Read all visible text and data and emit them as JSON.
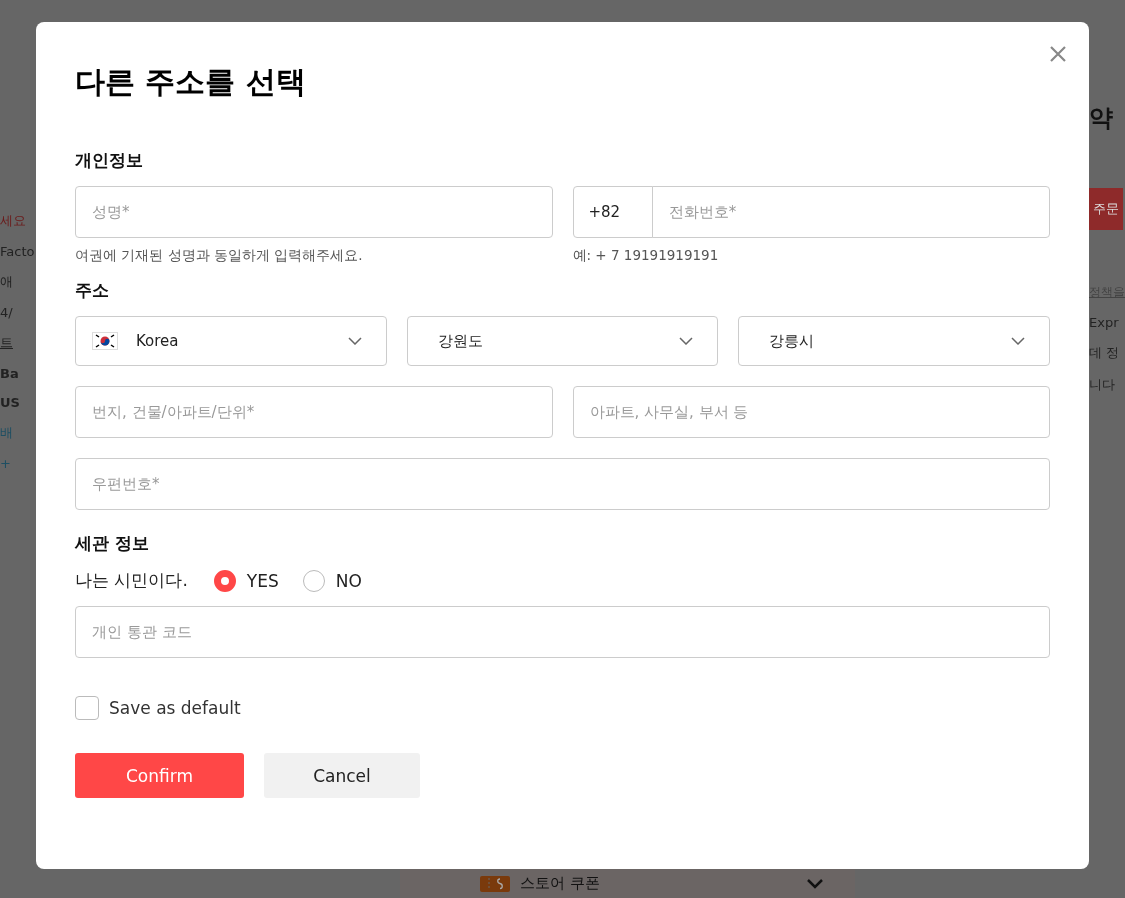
{
  "background": {
    "left_texts": [
      {
        "text": "세요",
        "kind": "warning"
      },
      {
        "text": "Facto",
        "kind": "plain"
      },
      {
        "text": "애",
        "kind": "plain"
      },
      {
        "text": "4/",
        "kind": "plain"
      },
      {
        "text": "트",
        "kind": "link"
      },
      {
        "text": "Ba",
        "kind": "bold"
      },
      {
        "text": "US",
        "kind": "price"
      },
      {
        "text": "배",
        "kind": "info"
      },
      {
        "text": "+",
        "kind": "info"
      }
    ],
    "right_texts": [
      {
        "text": "약",
        "kind": "heading"
      },
      {
        "text": "주문",
        "kind": "button"
      },
      {
        "text": "정책을",
        "kind": "link"
      },
      {
        "text": "Expr",
        "kind": "plain"
      },
      {
        "text": "데 정",
        "kind": "plain"
      },
      {
        "text": "니다",
        "kind": "plain"
      }
    ],
    "bottom_bar": {
      "label": "스토어 쿠폰"
    }
  },
  "dialog": {
    "title": "다른 주소를 선택",
    "personal": {
      "heading": "개인정보",
      "name_placeholder": "성명*",
      "name_hint": "여권에 기재된 성명과 동일하게 입력해주세요.",
      "country_code": "+82",
      "phone_placeholder": "전화번호*",
      "phone_hint": "예: + 7 19191919191"
    },
    "address": {
      "heading": "주소",
      "selects": [
        {
          "value": "Korea",
          "kind": "country"
        },
        {
          "value": "강원도",
          "kind": "plain"
        },
        {
          "value": "강릉시",
          "kind": "plain"
        }
      ],
      "street_placeholder": "번지, 건물/아파트/단위*",
      "unit_placeholder": "아파트, 사무실, 부서 등",
      "zip_placeholder": "우편번호*"
    },
    "customs": {
      "heading": "세관 정보",
      "question": "나는 시민이다.",
      "options": [
        {
          "label": "YES",
          "selected": true
        },
        {
          "label": "NO",
          "selected": false
        }
      ],
      "code_placeholder": "개인 통관 코드"
    },
    "save_default": {
      "label": "Save as default",
      "checked": false
    },
    "buttons": [
      {
        "label": "Confirm",
        "kind": "primary"
      },
      {
        "label": "Cancel",
        "kind": "secondary"
      }
    ]
  }
}
